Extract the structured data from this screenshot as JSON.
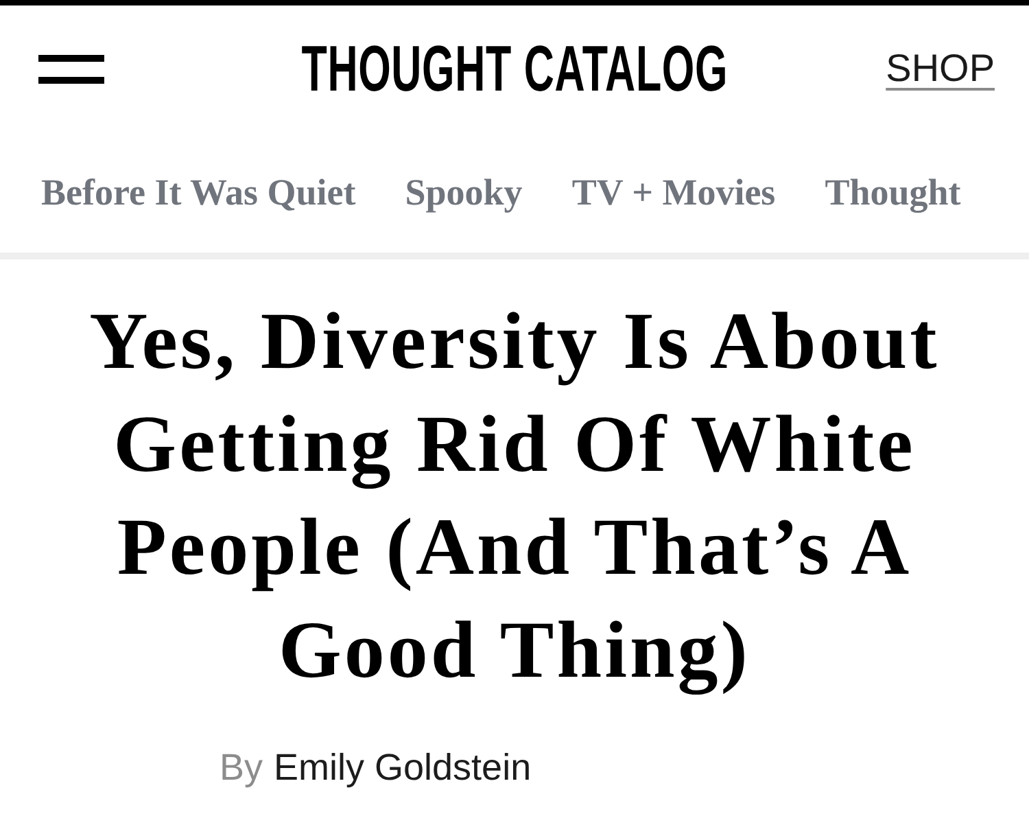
{
  "header": {
    "logo": "THOUGHT CATALOG",
    "shop_link": "SHOP"
  },
  "nav": {
    "items": [
      {
        "label": "Before It Was Quiet"
      },
      {
        "label": "Spooky"
      },
      {
        "label": "TV + Movies"
      },
      {
        "label": "Thought"
      }
    ]
  },
  "article": {
    "title": "Yes, Diversity Is About Getting Rid Of White People (And That’s A Good Thing)",
    "byline": {
      "prefix": "By",
      "author": "Emily Goldstein"
    }
  }
}
